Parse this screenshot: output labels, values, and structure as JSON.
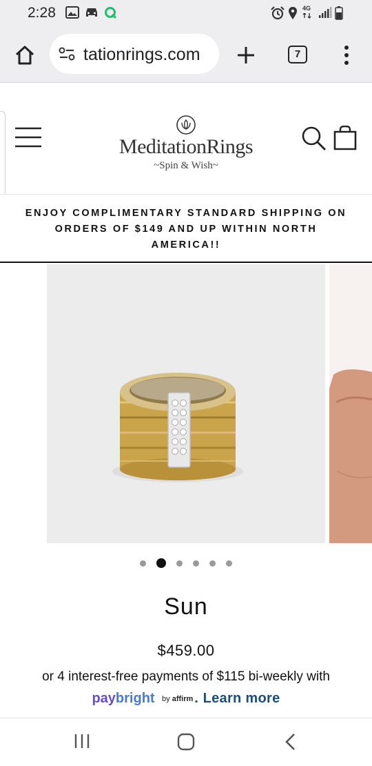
{
  "status_bar": {
    "time": "2:28",
    "network": "4G",
    "icons": [
      "gallery-icon",
      "car-icon",
      "q-app-icon",
      "alarm-icon",
      "location-icon",
      "signal-icon",
      "battery-icon"
    ]
  },
  "browser": {
    "url": "tationrings.com",
    "tab_count": "7",
    "icons": [
      "home-icon",
      "site-settings-icon",
      "new-tab-icon",
      "tabs-icon",
      "more-menu-icon"
    ]
  },
  "site": {
    "brand_name": "MeditationRings",
    "brand_tagline": "~Spin & Wish~",
    "icons": [
      "menu-icon",
      "lotus-logo-icon",
      "search-icon",
      "cart-icon"
    ]
  },
  "announcement": {
    "text": "ENJOY COMPLIMENTARY STANDARD SHIPPING ON ORDERS OF $149 AND UP WITHIN NORTH AMERICA!!"
  },
  "gallery": {
    "slide_count": 6,
    "active_slide": 2
  },
  "product": {
    "title": "Sun",
    "price": "$459.00",
    "installments": "or 4 interest-free payments of $115 bi-weekly with",
    "paybright_pay": "pay",
    "paybright_bright": "bright",
    "by_affirm_prefix": "by",
    "affirm_word": "affirm",
    "learn_more_prefix": ".",
    "learn_more": "Learn more"
  },
  "navbar": {
    "icons": [
      "recents-icon",
      "home-nav-icon",
      "back-icon"
    ]
  },
  "colors": {
    "chrome_bg": "#eeeef0",
    "paybright_purple": "#6a4bd6",
    "learn_more_blue": "#1c4e7a",
    "active_dot": "#111111",
    "inactive_dot": "#9a9a9a"
  }
}
